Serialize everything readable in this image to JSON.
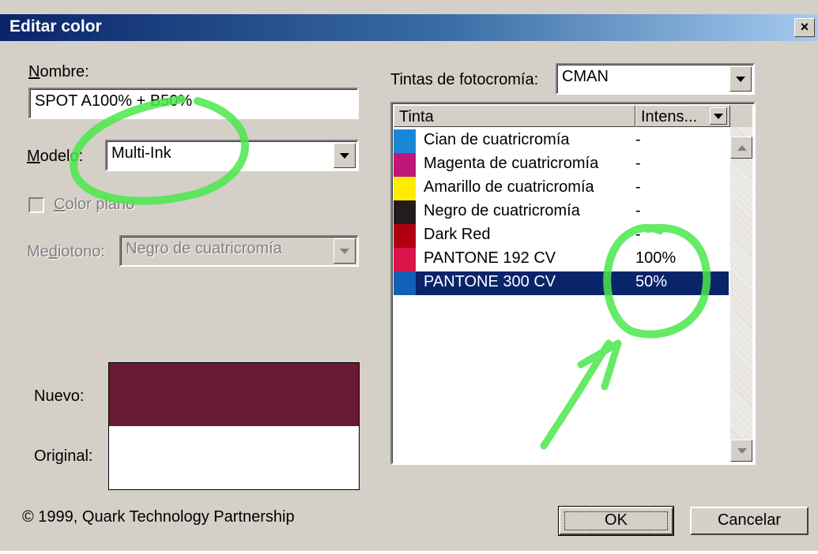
{
  "window": {
    "title": "Editar color",
    "close_glyph": "×"
  },
  "left": {
    "nombre_label": "Nombre:",
    "nombre_value": "SPOT A100% + B50%",
    "modelo_label": "Modelo:",
    "modelo_value": "Multi-Ink",
    "color_plano_label": "Color plano",
    "color_plano_checked": false,
    "mediotono_label": "Mediotono:",
    "mediotono_value": "Negro de cuatricromía",
    "nuevo_label": "Nuevo:",
    "original_label": "Original:",
    "nuevo_color": "#6b1a33",
    "original_color": "#ffffff",
    "copyright": "© 1999, Quark Technology Partnership"
  },
  "right": {
    "tintas_label": "Tintas de fotocromía:",
    "tintas_value": "CMAN",
    "columns": [
      "Tinta",
      "Intens..."
    ],
    "inks": [
      {
        "name": "Cian de cuatricromía",
        "value": "-",
        "color": "#1a86d8"
      },
      {
        "name": "Magenta de cuatricromía",
        "value": "-",
        "color": "#c0157a"
      },
      {
        "name": "Amarillo de cuatricromía",
        "value": "-",
        "color": "#ffec00"
      },
      {
        "name": "Negro de cuatricromía",
        "value": "-",
        "color": "#221c1e"
      },
      {
        "name": "Dark Red",
        "value": "-",
        "color": "#b00010"
      },
      {
        "name": "PANTONE 192 CV",
        "value": "100%",
        "color": "#d9144a"
      },
      {
        "name": "PANTONE 300 CV",
        "value": "50%",
        "color": "#1460b8",
        "selected": true
      }
    ]
  },
  "buttons": {
    "ok": "OK",
    "cancel": "Cancelar"
  },
  "colors": {
    "selection": "#0a246a",
    "annotation": "#4ae84a",
    "dialog_bg": "#d4d0c8"
  }
}
